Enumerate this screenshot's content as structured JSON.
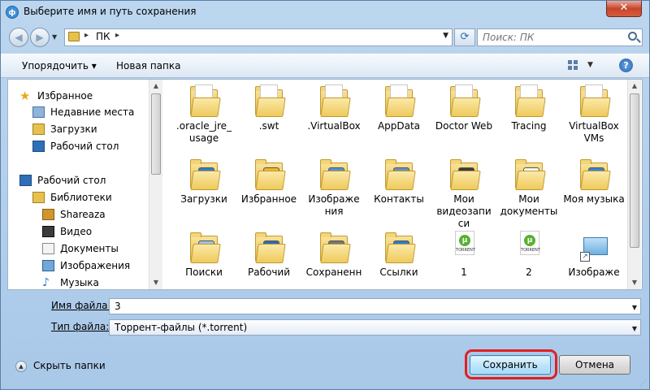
{
  "window": {
    "title": "Выберите имя и путь сохранения",
    "app_icon_glyph": "ф",
    "close_glyph": "✕"
  },
  "nav": {
    "back_glyph": "◀",
    "forward_glyph": "▶",
    "address_path": "ПК",
    "address_sep": "▸",
    "search_placeholder": "Поиск: ПК",
    "refresh_glyph": "⟳"
  },
  "toolbar": {
    "organize_label": "Упорядочить ▾",
    "new_folder_label": "Новая папка",
    "help_glyph": "?",
    "view_dd_glyph": "▼"
  },
  "navpane": {
    "items": [
      {
        "label": "Избранное",
        "icon": "star-icon"
      },
      {
        "label": "Недавние места",
        "icon": "recent-places-icon"
      },
      {
        "label": "Загрузки",
        "icon": "downloads-icon"
      },
      {
        "label": "Рабочий стол",
        "icon": "desktop-icon"
      },
      {
        "label": "Рабочий стол",
        "icon": "desktop-icon"
      },
      {
        "label": "Библиотеки",
        "icon": "libraries-icon"
      },
      {
        "label": "Shareaza",
        "icon": "shareaza-icon"
      },
      {
        "label": "Видео",
        "icon": "video-icon"
      },
      {
        "label": "Документы",
        "icon": "documents-icon"
      },
      {
        "label": "Изображения",
        "icon": "pictures-icon"
      },
      {
        "label": "Музыка",
        "icon": "music-icon"
      }
    ]
  },
  "files": [
    {
      "label": ".oracle_jre_ usage",
      "icon": "folder-icon"
    },
    {
      "label": ".swt",
      "icon": "folder-icon"
    },
    {
      "label": ".VirtualBox",
      "icon": "folder-icon"
    },
    {
      "label": "AppData",
      "icon": "folder-icon"
    },
    {
      "label": "Doctor Web",
      "icon": "folder-icon"
    },
    {
      "label": "Tracing",
      "icon": "folder-icon"
    },
    {
      "label": "VirtualBox VMs",
      "icon": "folder-icon"
    },
    {
      "label": "Загрузки",
      "icon": "downloads-folder-icon"
    },
    {
      "label": "Избранное",
      "icon": "favorites-folder-icon"
    },
    {
      "label": "Изображе ния",
      "icon": "pictures-folder-icon"
    },
    {
      "label": "Контакты",
      "icon": "contacts-folder-icon"
    },
    {
      "label": "Мои видеозапи си",
      "icon": "video-folder-icon"
    },
    {
      "label": "Мои документы",
      "icon": "documents-folder-icon"
    },
    {
      "label": "Моя музыка",
      "icon": "music-folder-icon"
    },
    {
      "label": "Поиски",
      "icon": "searches-folder-icon"
    },
    {
      "label": "Рабочий",
      "icon": "desktop-folder-icon"
    },
    {
      "label": "Сохраненн",
      "icon": "saved-games-folder-icon"
    },
    {
      "label": "Ссылки",
      "icon": "links-folder-icon"
    },
    {
      "label": "1",
      "icon": "torrent-file-icon"
    },
    {
      "label": "2",
      "icon": "torrent-file-icon"
    },
    {
      "label": "Изображе",
      "icon": "picture-shortcut-icon"
    }
  ],
  "torrent_badge": {
    "glyph": "µ",
    "text": "TORRENT"
  },
  "form": {
    "filename_label": "Имя файла:",
    "filename_value": "3",
    "filetype_label": "Тип файла:",
    "filetype_value": "Торрент-файлы (*.torrent)",
    "dd_glyph": "▼"
  },
  "footer": {
    "hide_folders_label": "Скрыть папки",
    "hide_folders_glyph": "▲",
    "save_label": "Сохранить",
    "cancel_label": "Отмена"
  },
  "scroll": {
    "up_glyph": "▲",
    "down_glyph": "▼"
  },
  "colors": {
    "highlight": "#e02020",
    "folder": "#efca5c",
    "accent": "#3c7fb1"
  }
}
